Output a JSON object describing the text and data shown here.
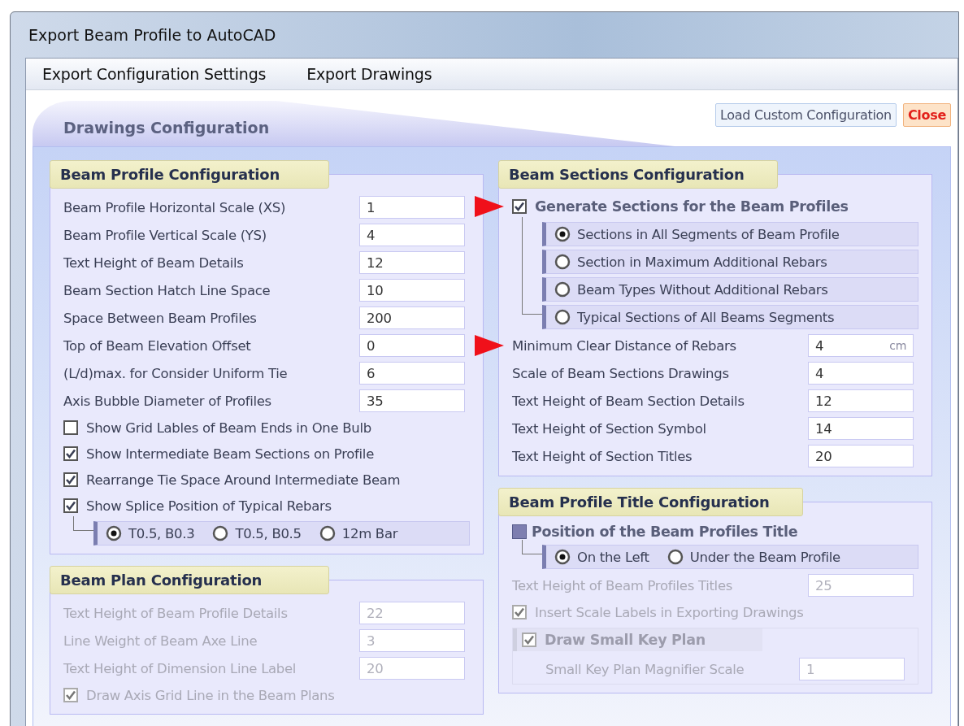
{
  "window": {
    "title": "Export Beam Profile to AutoCAD"
  },
  "menu": [
    {
      "label": "Export Configuration Settings"
    },
    {
      "label": "Export Drawings"
    }
  ],
  "tab": {
    "label": "Drawings Configuration"
  },
  "buttons": [
    {
      "label": "Load Custom Configuration",
      "kind": "default"
    },
    {
      "label": "Close",
      "kind": "danger"
    }
  ],
  "columns": [
    {
      "panels": [
        {
          "title": "Beam Profile Configuration",
          "items": [
            {
              "kind": "field",
              "label": "Beam Profile Horizontal Scale  (XS)",
              "value": "1",
              "disabled": false
            },
            {
              "kind": "field",
              "label": "Beam Profile Vertical  Scale     (YS)",
              "value": "4",
              "disabled": false
            },
            {
              "kind": "field",
              "label": "Text Height of Beam Details",
              "value": "12",
              "disabled": false
            },
            {
              "kind": "field",
              "label": "Beam Section Hatch Line Space",
              "value": "10",
              "disabled": false
            },
            {
              "kind": "field",
              "label": "Space Between Beam Profiles",
              "value": "200",
              "disabled": false
            },
            {
              "kind": "field",
              "label": "Top of  Beam Elevation Offset",
              "value": "0",
              "disabled": false
            },
            {
              "kind": "field",
              "label": "(L/d)max. for Consider Uniform Tie",
              "value": "6",
              "disabled": false
            },
            {
              "kind": "field",
              "label": "Axis Bubble Diameter of  Profiles",
              "value": "35",
              "disabled": false
            },
            {
              "kind": "check",
              "label": "Show Grid Lables of Beam Ends in One Bulb",
              "checked": false,
              "disabled": false
            },
            {
              "kind": "check",
              "label": "Show Intermediate Beam Sections on Profile",
              "checked": true,
              "disabled": false
            },
            {
              "kind": "check",
              "label": "Rearrange Tie Space Around Intermediate Beam",
              "checked": true,
              "disabled": false
            },
            {
              "kind": "check",
              "label": "Show Splice Position of Typical Rebars",
              "checked": true,
              "disabled": false
            },
            {
              "kind": "radio-row",
              "options": [
                {
                  "label": "T0.5, B0.3",
                  "selected": true
                },
                {
                  "label": "T0.5, B0.5",
                  "selected": false
                },
                {
                  "label": "12m Bar",
                  "selected": false
                }
              ]
            }
          ]
        },
        {
          "title": "Beam Plan Configuration",
          "items": [
            {
              "kind": "field",
              "label": "Text Height of Beam Profile Details",
              "value": "22",
              "disabled": true
            },
            {
              "kind": "field",
              "label": "Line Weight of Beam Axe Line",
              "value": "3",
              "disabled": true
            },
            {
              "kind": "field",
              "label": "Text Height of Dimension Line Label",
              "value": "20",
              "disabled": true
            },
            {
              "kind": "check",
              "label": "Draw Axis Grid Line in the Beam Plans",
              "checked": true,
              "disabled": true
            }
          ]
        }
      ]
    },
    {
      "panels": [
        {
          "title": "Beam Sections Configuration",
          "items": [
            {
              "kind": "check",
              "label": "Generate Sections for the Beam Profiles",
              "checked": true,
              "disabled": false,
              "bold": true,
              "pointer": true
            },
            {
              "kind": "radio-column",
              "options": [
                {
                  "label": "Sections in All Segments of Beam Profile",
                  "selected": true
                },
                {
                  "label": "Section in Maximum Additional Rebars",
                  "selected": false
                },
                {
                  "label": "Beam Types Without Additional Rebars",
                  "selected": false
                },
                {
                  "label": "Typical Sections of All Beams Segments",
                  "selected": false
                }
              ]
            },
            {
              "kind": "field",
              "label": "Minimum Clear Distance of Rebars",
              "value": "4",
              "unit": "cm",
              "disabled": false,
              "pointer": true
            },
            {
              "kind": "field",
              "label": "Scale of Beam Sections Drawings",
              "value": "4",
              "disabled": false
            },
            {
              "kind": "field",
              "label": "Text Height of Beam Section Details",
              "value": "12",
              "disabled": false
            },
            {
              "kind": "field",
              "label": "Text Height of Section Symbol",
              "value": "14",
              "disabled": false
            },
            {
              "kind": "field",
              "label": "Text  Height of Section Titles",
              "value": "20",
              "disabled": false
            }
          ]
        },
        {
          "title": "Beam Profile Title Configuration",
          "items": [
            {
              "kind": "heading",
              "label": "Position of the Beam Profiles Title",
              "checked": true
            },
            {
              "kind": "radio-row",
              "options": [
                {
                  "label": "On the Left",
                  "selected": true
                },
                {
                  "label": "Under the Beam Profile",
                  "selected": false
                }
              ]
            },
            {
              "kind": "field",
              "label": "Text Height of Beam Profiles Titles",
              "value": "25",
              "disabled": true
            },
            {
              "kind": "check",
              "label": "Insert Scale Labels in Exporting Drawings",
              "checked": true,
              "disabled": true
            },
            {
              "kind": "check-group",
              "label": "Draw Small Key Plan",
              "checked": true,
              "disabled": true,
              "items": [
                {
                  "kind": "field",
                  "label": "Small Key Plan Magnifier Scale",
                  "value": "1",
                  "disabled": true
                }
              ]
            }
          ]
        }
      ]
    }
  ]
}
